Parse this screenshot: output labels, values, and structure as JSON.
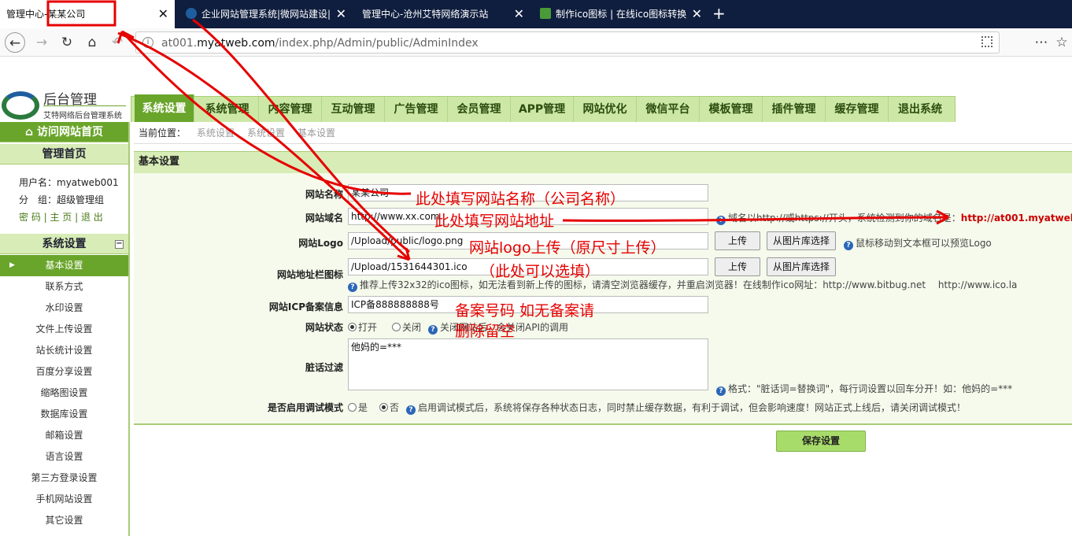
{
  "browser": {
    "tabs": [
      {
        "label_prefix": "管理中心-",
        "label_highlight": "某某公司",
        "active": true
      },
      {
        "label": "企业网站管理系统|微网站建设|"
      },
      {
        "label": "管理中心-沧州艾特网络演示站"
      },
      {
        "label": "制作ico图标 | 在线ico图标转换"
      }
    ],
    "new_tab": "+",
    "close_glyph": "✕",
    "url_prefix": "at001.",
    "url_domain": "myatweb.com",
    "url_path": "/index.php/Admin/public/AdminIndex"
  },
  "header": {
    "logo_title": "后台管理",
    "logo_subtitle": "艾特网络后台管理系统",
    "menu": [
      "系统设置",
      "系统管理",
      "内容管理",
      "互动管理",
      "广告管理",
      "会员管理",
      "APP管理",
      "网站优化",
      "微信平台",
      "模板管理",
      "插件管理",
      "缓存管理",
      "退出系统"
    ]
  },
  "sidebar": {
    "visit_home": "访问网站首页",
    "admin_home": "管理首页",
    "username_label": "用户名：",
    "username": "myatweb001",
    "group_label": "分　组：",
    "group": "超级管理组",
    "links": "密 码 | 主 页 | 退 出",
    "section": "系统设置",
    "collapse": "−",
    "items": [
      "基本设置",
      "联系方式",
      "水印设置",
      "文件上传设置",
      "站长统计设置",
      "百度分享设置",
      "缩略图设置",
      "数据库设置",
      "邮箱设置",
      "语言设置",
      "第三方登录设置",
      "手机网站设置",
      "其它设置"
    ]
  },
  "breadcrumb": {
    "label": "当前位置：",
    "items": [
      "系统设置",
      "系统设置",
      "基本设置"
    ]
  },
  "section_title": "基本设置",
  "form": {
    "site_name": {
      "label": "网站名称",
      "value": "某某公司"
    },
    "domain": {
      "label": "网站域名",
      "value": "http://www.xx.com",
      "hint": "域名以http://或https://开头，系统检测到你的域名是：",
      "detected": "http://at001.myatweb.com"
    },
    "logo": {
      "label": "网站Logo",
      "value": "/Upload/public/logo.png",
      "upload": "上传",
      "gallery": "从图片库选择",
      "hint": "鼠标移动到文本框可以预览Logo"
    },
    "favicon": {
      "label": "网站地址栏图标",
      "value": "/Upload/1531644301.ico",
      "upload": "上传",
      "gallery": "从图片库选择",
      "hint": "推荐上传32x32的ico图标，如无法看到新上传的图标，请清空浏览器缓存，并重启浏览器！在线制作ico网址：http://www.bitbug.net　 http://www.ico.la"
    },
    "icp": {
      "label": "网站ICP备案信息",
      "value": "ICP备888888888号"
    },
    "status": {
      "label": "网站状态",
      "open": "打开",
      "close": "关闭",
      "hint": "关闭网站后，会关闭API的调用"
    },
    "filter": {
      "label": "脏话过滤",
      "value": "他妈的=***",
      "hint": "格式：\"脏话词=替换词\"，每行词设置以回车分开！如：他妈的=***"
    },
    "debug": {
      "label": "是否启用调试模式",
      "yes": "是",
      "no": "否",
      "hint": "启用调试模式后，系统将保存各种状态日志，同时禁止缓存数据，有利于调试，但会影响速度！网站正式上线后，请关闭调试模式！"
    },
    "save": "保存设置"
  },
  "annotations": {
    "name": "此处填写网站名称（公司名称）",
    "domain": "此处填写网站地址",
    "logo": "网站logo上传（原尺寸上传）",
    "favicon": "（此处可以选填）",
    "icp_line1": "备案号码  如无备案请",
    "icp_line2": "删除留空"
  },
  "colors": {
    "accent_green": "#6aa52b",
    "light_green": "#d7ecb6",
    "annotation_red": "#e60000"
  }
}
